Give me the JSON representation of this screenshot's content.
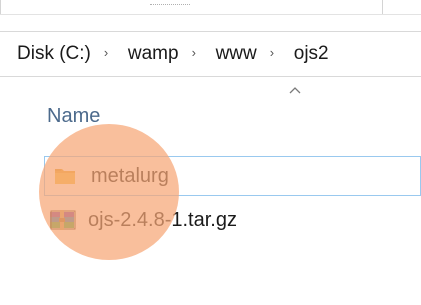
{
  "address_bar": {
    "crumbs": [
      "Disk (C:)",
      "wamp",
      "www",
      "ojs2"
    ],
    "separator": "›"
  },
  "file_list": {
    "column_header": "Name",
    "sort_indicator": "chevron-up-icon",
    "items": [
      {
        "name": "metalurg",
        "icon": "folder-icon",
        "selected": true
      },
      {
        "name": "ojs-2.4.8-1.tar.gz",
        "icon": "winrar-archive-icon",
        "selected": false
      }
    ]
  },
  "colors": {
    "selection_border": "#99c9ef",
    "header_text": "#4c6a8c",
    "folder": "#f4c04a",
    "click_highlight": "#f6a676"
  }
}
